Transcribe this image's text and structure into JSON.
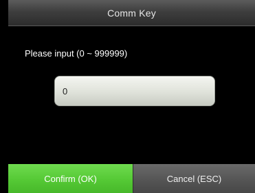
{
  "window": {
    "title": "Comm Key"
  },
  "form": {
    "prompt": "Please input (0 ~ 999999)",
    "input_value": "0"
  },
  "footer": {
    "confirm_label": "Confirm (OK)",
    "cancel_label": "Cancel (ESC)"
  },
  "colors": {
    "confirm_button": "#55c935",
    "cancel_button": "#555555",
    "title_bar": "#3e3e3e",
    "background": "#000000"
  }
}
